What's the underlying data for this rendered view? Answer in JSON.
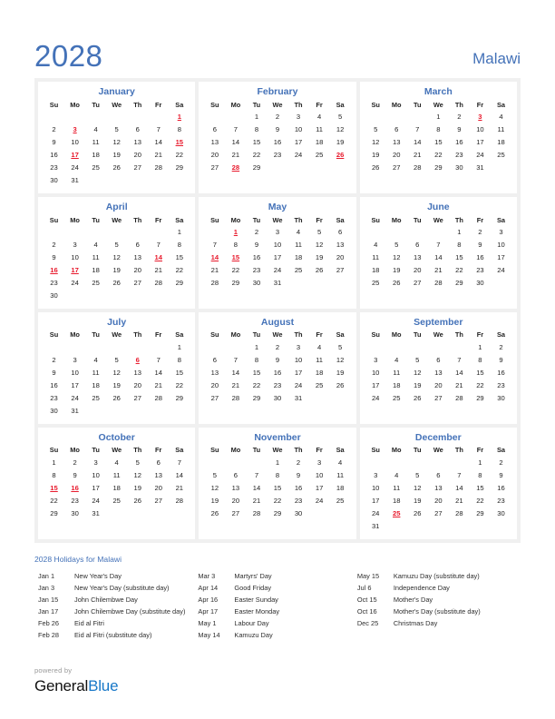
{
  "header": {
    "year": "2028",
    "country": "Malawi",
    "accent_color": "#4472b8",
    "holiday_color": "#e8192c"
  },
  "weekdays": [
    "Su",
    "Mo",
    "Tu",
    "We",
    "Th",
    "Fr",
    "Sa"
  ],
  "months": [
    {
      "name": "January",
      "lead_blanks": 6,
      "days": 31,
      "holidays": [
        1,
        3,
        15,
        17
      ]
    },
    {
      "name": "February",
      "lead_blanks": 2,
      "days": 29,
      "holidays": [
        26,
        28
      ]
    },
    {
      "name": "March",
      "lead_blanks": 3,
      "days": 31,
      "holidays": [
        3
      ]
    },
    {
      "name": "April",
      "lead_blanks": 6,
      "days": 30,
      "holidays": [
        14,
        16,
        17
      ]
    },
    {
      "name": "May",
      "lead_blanks": 1,
      "days": 31,
      "holidays": [
        1,
        14,
        15
      ]
    },
    {
      "name": "June",
      "lead_blanks": 4,
      "days": 30,
      "holidays": []
    },
    {
      "name": "July",
      "lead_blanks": 6,
      "days": 31,
      "holidays": [
        6
      ]
    },
    {
      "name": "August",
      "lead_blanks": 2,
      "days": 31,
      "holidays": []
    },
    {
      "name": "September",
      "lead_blanks": 5,
      "days": 30,
      "holidays": []
    },
    {
      "name": "October",
      "lead_blanks": 0,
      "days": 31,
      "holidays": [
        15,
        16
      ]
    },
    {
      "name": "November",
      "lead_blanks": 3,
      "days": 30,
      "holidays": []
    },
    {
      "name": "December",
      "lead_blanks": 5,
      "days": 31,
      "holidays": [
        25
      ]
    }
  ],
  "holidays_section": {
    "heading": "2028 Holidays for Malawi",
    "columns": [
      [
        {
          "date": "Jan 1",
          "name": "New Year's Day"
        },
        {
          "date": "Jan 3",
          "name": "New Year's Day (substitute day)"
        },
        {
          "date": "Jan 15",
          "name": "John Chilembwe Day"
        },
        {
          "date": "Jan 17",
          "name": "John Chilembwe Day (substitute day)"
        },
        {
          "date": "Feb 26",
          "name": "Eid al Fitri"
        },
        {
          "date": "Feb 28",
          "name": "Eid al Fitri (substitute day)"
        }
      ],
      [
        {
          "date": "Mar 3",
          "name": "Martyrs' Day"
        },
        {
          "date": "Apr 14",
          "name": "Good Friday"
        },
        {
          "date": "Apr 16",
          "name": "Easter Sunday"
        },
        {
          "date": "Apr 17",
          "name": "Easter Monday"
        },
        {
          "date": "May 1",
          "name": "Labour Day"
        },
        {
          "date": "May 14",
          "name": "Kamuzu Day"
        }
      ],
      [
        {
          "date": "May 15",
          "name": "Kamuzu Day (substitute day)"
        },
        {
          "date": "Jul 6",
          "name": "Independence Day"
        },
        {
          "date": "Oct 15",
          "name": "Mother's Day"
        },
        {
          "date": "Oct 16",
          "name": "Mother's Day (substitute day)"
        },
        {
          "date": "Dec 25",
          "name": "Christmas Day"
        }
      ]
    ]
  },
  "footer": {
    "powered_by": "powered by",
    "brand_first": "General",
    "brand_second": "Blue"
  }
}
